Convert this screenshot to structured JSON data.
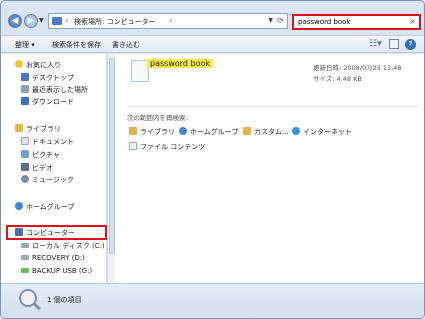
{
  "address": {
    "path": "検索場所: コンピューター"
  },
  "search": {
    "value": "password book"
  },
  "toolbar": {
    "organize": "整理",
    "save_search": "検索条件を保存",
    "burn": "書き込む"
  },
  "nav": {
    "favorites": "お気に入り",
    "desktop": "デスクトップ",
    "recent": "最近表示した場所",
    "downloads": "ダウンロード",
    "libraries": "ライブラリ",
    "documents": "ドキュメント",
    "pictures": "ピクチャ",
    "videos": "ビデオ",
    "music": "ミュージック",
    "homegroup": "ホームグループ",
    "computer": "コンピューター",
    "local_disk": "ローカル ディスク (C:)",
    "recovery": "RECOVERY (D:)",
    "backup_usb": "BACKUP USB (G:)"
  },
  "result": {
    "name": "password book",
    "modified": "更新日時: 2008/07/23 13:48",
    "size": "サイズ: 4.48 KB"
  },
  "research": {
    "label": "次の範囲内を再検索:",
    "links": [
      "ライブラリ",
      "ホームグループ",
      "カスタム...",
      "インターネット",
      "ファイル コンテンツ"
    ]
  },
  "status": {
    "count": "1 個の項目"
  },
  "colors": {
    "highlight_red": "#e4101e",
    "match_yellow": "#f7e94a"
  }
}
